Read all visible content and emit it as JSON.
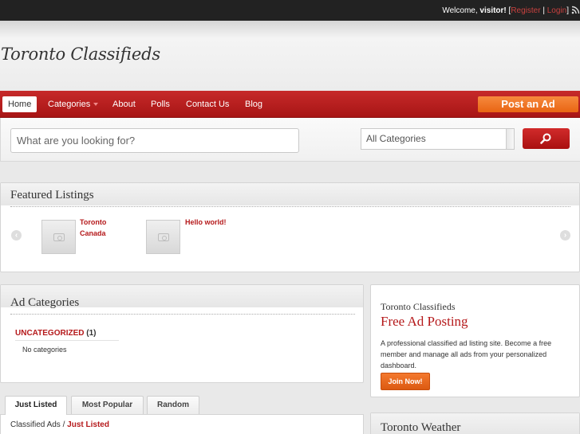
{
  "topbar": {
    "welcome_prefix": "Welcome,",
    "user": "visitor!",
    "open_bracket": "[",
    "register": "Register",
    "separator": "|",
    "login": "Login",
    "close_bracket": "]"
  },
  "header": {
    "logo": "Toronto Classifieds"
  },
  "nav": {
    "items": [
      {
        "label": "Home"
      },
      {
        "label": "Categories"
      },
      {
        "label": "About"
      },
      {
        "label": "Polls"
      },
      {
        "label": "Contact Us"
      },
      {
        "label": "Blog"
      }
    ],
    "post_ad": "Post an Ad"
  },
  "search": {
    "placeholder": "What are you looking for?",
    "category_selected": "All Categories"
  },
  "featured": {
    "title": "Featured Listings",
    "items": [
      {
        "title": "Toronto Canada"
      },
      {
        "title": "Hello world!"
      }
    ]
  },
  "ad_categories": {
    "title": "Ad Categories",
    "category": "UNCATEGORIZED",
    "count": "(1)",
    "empty_text": "No categories"
  },
  "sidebar": {
    "site_name": "Toronto Classifieds",
    "headline": "Free Ad Posting",
    "description": "A professional classified ad listing site. Become a free member and manage all ads from your personalized dashboard.",
    "join_button": "Join Now!",
    "weather_title": "Toronto Weather"
  },
  "listings": {
    "tabs": [
      {
        "label": "Just Listed"
      },
      {
        "label": "Most Popular"
      },
      {
        "label": "Random"
      }
    ],
    "breadcrumb_root": "Classified Ads",
    "breadcrumb_sep": "/",
    "breadcrumb_current": "Just Listed"
  },
  "colors": {
    "accent_red": "#b5191b",
    "nav_red": "#c62a2a",
    "post_orange": "#f6893d"
  }
}
